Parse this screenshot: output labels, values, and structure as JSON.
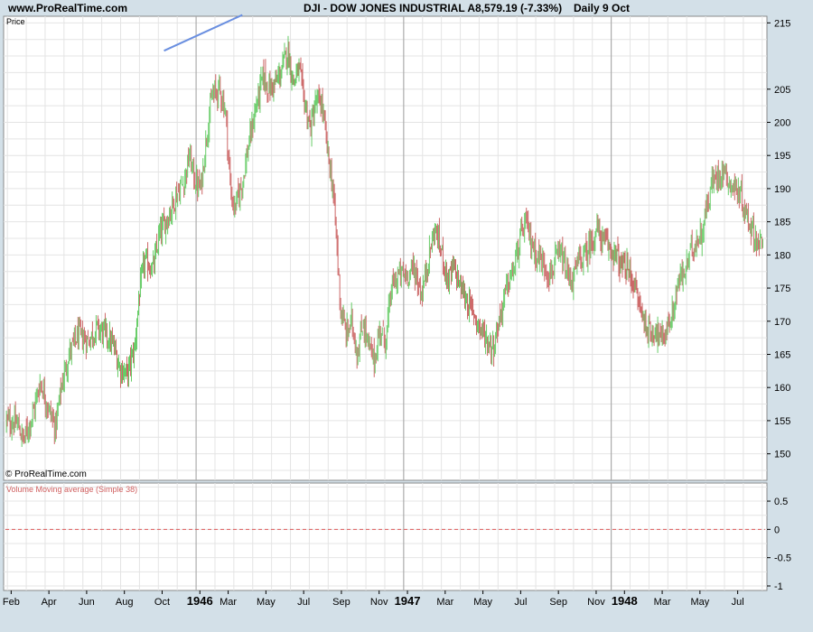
{
  "header": {
    "site": "www.ProRealTime.com",
    "title": "DJI - DOW JONES INDUSTRIAL A",
    "quote": "8,579.19 (-7.33%)",
    "period": "Daily  9 Oct"
  },
  "price_panel": {
    "label": "Price",
    "copyright": "© ProRealTime.com"
  },
  "volume_panel": {
    "label": "Volume Moving average (Simple 38)"
  },
  "chart_data": [
    {
      "type": "candlestick",
      "panel": "Price",
      "y_ticks": [
        150,
        155,
        160,
        165,
        170,
        175,
        180,
        185,
        190,
        195,
        200,
        205,
        215
      ],
      "ylim": [
        146,
        216
      ],
      "x_ticks": [
        {
          "label": "Feb",
          "t": 0.25,
          "bold": false
        },
        {
          "label": "Apr",
          "t": 2.25,
          "bold": false
        },
        {
          "label": "Jun",
          "t": 4.25,
          "bold": false
        },
        {
          "label": "Aug",
          "t": 6.25,
          "bold": false
        },
        {
          "label": "Oct",
          "t": 8.25,
          "bold": false
        },
        {
          "label": "1946",
          "t": 10.25,
          "bold": true
        },
        {
          "label": "Mar",
          "t": 11.75,
          "bold": false
        },
        {
          "label": "May",
          "t": 13.75,
          "bold": false
        },
        {
          "label": "Jul",
          "t": 15.75,
          "bold": false
        },
        {
          "label": "Sep",
          "t": 17.75,
          "bold": false
        },
        {
          "label": "Nov",
          "t": 19.75,
          "bold": false
        },
        {
          "label": "1947",
          "t": 21.25,
          "bold": true
        },
        {
          "label": "Mar",
          "t": 23.25,
          "bold": false
        },
        {
          "label": "May",
          "t": 25.25,
          "bold": false
        },
        {
          "label": "Jul",
          "t": 27.25,
          "bold": false
        },
        {
          "label": "Sep",
          "t": 29.25,
          "bold": false
        },
        {
          "label": "Nov",
          "t": 31.25,
          "bold": false
        },
        {
          "label": "1948",
          "t": 32.75,
          "bold": true
        },
        {
          "label": "Mar",
          "t": 34.75,
          "bold": false
        },
        {
          "label": "May",
          "t": 36.75,
          "bold": false
        },
        {
          "label": "Jul",
          "t": 38.75,
          "bold": false
        }
      ],
      "xlim": [
        -0.15,
        40.3
      ],
      "year_dividers": [
        10.05,
        21.05,
        32.05
      ],
      "up_color": "#66cc66",
      "down_color": "#cc6666",
      "trendline": {
        "color": "#6a8fe0",
        "from": [
          8.35,
          210.8
        ],
        "to": [
          12.5,
          216.2
        ]
      },
      "close_path": [
        [
          0,
          155
        ],
        [
          0.6,
          154.5
        ],
        [
          0.9,
          152
        ],
        [
          1.4,
          156
        ],
        [
          1.8,
          161
        ],
        [
          2.2,
          157
        ],
        [
          2.6,
          154
        ],
        [
          2.9,
          160
        ],
        [
          3.3,
          165
        ],
        [
          3.8,
          168
        ],
        [
          4.3,
          167
        ],
        [
          4.8,
          169
        ],
        [
          5.3,
          168
        ],
        [
          5.7,
          166
        ],
        [
          6.0,
          163
        ],
        [
          6.4,
          162
        ],
        [
          6.8,
          166
        ],
        [
          7.0,
          173
        ],
        [
          7.3,
          179
        ],
        [
          7.8,
          178
        ],
        [
          8.1,
          183
        ],
        [
          8.6,
          186
        ],
        [
          9.0,
          189
        ],
        [
          9.4,
          191
        ],
        [
          9.7,
          195
        ],
        [
          10.0,
          191
        ],
        [
          10.3,
          190
        ],
        [
          10.6,
          198
        ],
        [
          10.9,
          204
        ],
        [
          11.3,
          205
        ],
        [
          11.6,
          202
        ],
        [
          11.9,
          189
        ],
        [
          12.1,
          187
        ],
        [
          12.5,
          191
        ],
        [
          12.8,
          196
        ],
        [
          13.2,
          202
        ],
        [
          13.6,
          207
        ],
        [
          13.9,
          205
        ],
        [
          14.3,
          206
        ],
        [
          14.6,
          208
        ],
        [
          14.9,
          211
        ],
        [
          15.2,
          206
        ],
        [
          15.5,
          208
        ],
        [
          15.8,
          203
        ],
        [
          16.1,
          199
        ],
        [
          16.4,
          203
        ],
        [
          16.7,
          203
        ],
        [
          17.0,
          196
        ],
        [
          17.3,
          190
        ],
        [
          17.5,
          182
        ],
        [
          17.7,
          172
        ],
        [
          18.0,
          168
        ],
        [
          18.3,
          170
        ],
        [
          18.6,
          165
        ],
        [
          18.9,
          170
        ],
        [
          19.2,
          166
        ],
        [
          19.5,
          164
        ],
        [
          19.8,
          169
        ],
        [
          20.1,
          167
        ],
        [
          20.4,
          175
        ],
        [
          20.8,
          177
        ],
        [
          21.2,
          177
        ],
        [
          21.6,
          178
        ],
        [
          22.0,
          174
        ],
        [
          22.4,
          180
        ],
        [
          22.7,
          184
        ],
        [
          23.1,
          180
        ],
        [
          23.4,
          176
        ],
        [
          23.7,
          178
        ],
        [
          24.1,
          175
        ],
        [
          24.4,
          173
        ],
        [
          24.8,
          171
        ],
        [
          25.1,
          169
        ],
        [
          25.5,
          167
        ],
        [
          25.8,
          166
        ],
        [
          26.1,
          170
        ],
        [
          26.5,
          175
        ],
        [
          26.9,
          178
        ],
        [
          27.2,
          182
        ],
        [
          27.5,
          185
        ],
        [
          27.8,
          182
        ],
        [
          28.1,
          180
        ],
        [
          28.4,
          179
        ],
        [
          28.8,
          177
        ],
        [
          29.1,
          179
        ],
        [
          29.4,
          180
        ],
        [
          29.7,
          177
        ],
        [
          30.0,
          176
        ],
        [
          30.3,
          179
        ],
        [
          30.7,
          180
        ],
        [
          31.0,
          182
        ],
        [
          31.3,
          184
        ],
        [
          31.6,
          182
        ],
        [
          32.0,
          181
        ],
        [
          32.3,
          180
        ],
        [
          32.6,
          178
        ],
        [
          32.9,
          178
        ],
        [
          33.2,
          176
        ],
        [
          33.5,
          173
        ],
        [
          33.8,
          170
        ],
        [
          34.1,
          168
        ],
        [
          34.4,
          169
        ],
        [
          34.7,
          167
        ],
        [
          35.0,
          169
        ],
        [
          35.3,
          171
        ],
        [
          35.6,
          176
        ],
        [
          35.9,
          177
        ],
        [
          36.2,
          180
        ],
        [
          36.5,
          182
        ],
        [
          36.8,
          183
        ],
        [
          37.1,
          187
        ],
        [
          37.4,
          191
        ],
        [
          37.7,
          192
        ],
        [
          38.0,
          193
        ],
        [
          38.3,
          191
        ],
        [
          38.6,
          190
        ],
        [
          38.9,
          189
        ],
        [
          39.2,
          186
        ],
        [
          39.5,
          184
        ],
        [
          39.8,
          182
        ],
        [
          40.1,
          181
        ]
      ]
    },
    {
      "type": "line",
      "panel": "Volume Moving average (Simple 38)",
      "y_ticks": [
        0.5,
        0,
        -0.5,
        -1
      ],
      "y_tick_labels": [
        "0.5",
        "0",
        "-0.5",
        "-1"
      ],
      "ylim": [
        -1.08,
        0.82
      ],
      "series": [
        {
          "values": [
            0
          ],
          "color": "#e05a5a",
          "dash": true
        }
      ]
    }
  ]
}
